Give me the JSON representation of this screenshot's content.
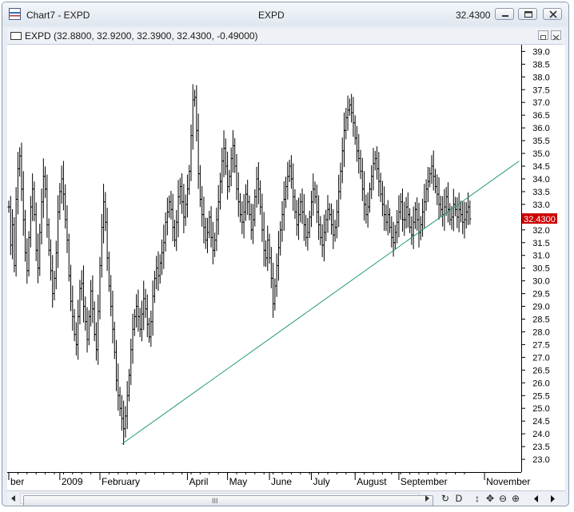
{
  "window": {
    "title": "Chart7 - EXPD",
    "center_title": "EXPD",
    "last_price": "32.4300"
  },
  "series_header": "EXPD (32.8800, 32.9200, 32.3900, 32.4300, -0.49000)",
  "toolbar": {
    "zoom_label": "D",
    "grip": "III"
  },
  "colors": {
    "trendline": "#1f9a63",
    "price_tag_bg": "#cc0000",
    "bars": "#000000"
  },
  "chart_data": {
    "type": "ohlc",
    "symbol": "EXPD",
    "last_price_label": "32.4300",
    "last_price": 32.43,
    "ylim": [
      22.5,
      39.2
    ],
    "y_ticks": [
      "39.0",
      "38.5",
      "38.0",
      "37.5",
      "37.0",
      "36.5",
      "36.0",
      "35.5",
      "35.0",
      "34.5",
      "34.0",
      "33.5",
      "33.0",
      "32.5",
      "32.0",
      "31.5",
      "31.0",
      "30.5",
      "30.0",
      "29.5",
      "29.0",
      "28.5",
      "28.0",
      "27.5",
      "27.0",
      "26.5",
      "26.0",
      "25.5",
      "25.0",
      "24.5",
      "24.0",
      "23.5",
      "23.0"
    ],
    "x_labels": [
      {
        "label": "ber",
        "bar": 0
      },
      {
        "label": "2009",
        "bar": 28
      },
      {
        "label": "February",
        "bar": 50
      },
      {
        "label": "April",
        "bar": 98
      },
      {
        "label": "May",
        "bar": 120
      },
      {
        "label": "June",
        "bar": 143
      },
      {
        "label": "July",
        "bar": 166
      },
      {
        "label": "August",
        "bar": 190
      },
      {
        "label": "September",
        "bar": 214
      },
      {
        "label": "November",
        "bar": 261
      }
    ],
    "closes": [
      32.9,
      31.4,
      32.2,
      30.6,
      33.2,
      34.4,
      34.9,
      33.6,
      32.4,
      31.1,
      30.4,
      31.7,
      32.9,
      33.6,
      32.6,
      31.2,
      30.5,
      31.9,
      33.1,
      34.1,
      33.6,
      32.2,
      31.2,
      30.4,
      29.5,
      30.1,
      31.1,
      32.7,
      33.5,
      34.0,
      33.4,
      32.4,
      31.6,
      30.2,
      29.2,
      28.6,
      27.9,
      27.5,
      28.6,
      29.7,
      29.9,
      29.0,
      28.4,
      27.7,
      28.6,
      29.6,
      28.9,
      27.9,
      27.3,
      28.8,
      30.6,
      32.1,
      33.1,
      32.3,
      30.9,
      29.8,
      29.0,
      28.1,
      27.2,
      26.1,
      25.5,
      25.0,
      24.6,
      24.2,
      24.7,
      25.5,
      26.3,
      27.3,
      28.1,
      28.6,
      29.0,
      28.6,
      28.1,
      28.7,
      29.3,
      28.9,
      28.3,
      27.8,
      28.4,
      29.4,
      30.1,
      30.5,
      30.2,
      30.7,
      31.1,
      31.5,
      32.3,
      32.7,
      33.1,
      32.8,
      32.1,
      31.6,
      32.3,
      33.3,
      33.7,
      33.1,
      32.5,
      33.0,
      33.6,
      34.3,
      35.7,
      37.1,
      37.2,
      35.9,
      34.2,
      33.2,
      32.6,
      32.1,
      31.6,
      31.9,
      32.5,
      31.7,
      31.2,
      31.6,
      32.4,
      33.1,
      33.9,
      34.7,
      35.2,
      34.5,
      33.7,
      34.1,
      34.8,
      35.3,
      34.5,
      33.6,
      33.1,
      32.6,
      32.3,
      32.7,
      33.4,
      33.1,
      32.6,
      32.0,
      32.4,
      33.3,
      34.0,
      33.6,
      32.9,
      32.0,
      31.2,
      30.9,
      31.6,
      30.9,
      30.1,
      29.1,
      29.8,
      30.6,
      31.3,
      32.0,
      32.6,
      33.2,
      33.7,
      34.1,
      34.5,
      34.0,
      33.3,
      32.7,
      32.2,
      32.6,
      33.1,
      32.7,
      32.2,
      31.7,
      31.9,
      32.5,
      33.1,
      33.6,
      33.3,
      32.7,
      32.2,
      31.7,
      31.4,
      31.9,
      32.4,
      32.8,
      32.6,
      32.2,
      31.8,
      32.1,
      32.7,
      33.5,
      34.3,
      35.1,
      35.9,
      36.4,
      36.7,
      36.9,
      36.6,
      36.2,
      35.6,
      35.1,
      34.8,
      34.3,
      33.6,
      33.0,
      32.6,
      32.9,
      33.6,
      34.1,
      34.6,
      34.8,
      34.4,
      33.9,
      33.4,
      33.0,
      32.6,
      32.3,
      32.6,
      32.1,
      31.7,
      31.5,
      31.9,
      32.3,
      32.7,
      33.1,
      32.4,
      32.4,
      32.9,
      32.6,
      32.1,
      31.8,
      32.3,
      32.8,
      32.4,
      31.9,
      32.2,
      32.7,
      33.1,
      33.6,
      33.9,
      34.2,
      34.5,
      34.1,
      33.7,
      33.4,
      33.0,
      32.8,
      32.6,
      32.9,
      33.3,
      32.8,
      32.4,
      32.5,
      33.0,
      32.8,
      32.5,
      32.8,
      32.6,
      32.3,
      32.4,
      32.7,
      32.9,
      32.43
    ],
    "trendline": {
      "start": {
        "bar": 62,
        "price": 23.6
      },
      "end": {
        "bar": 280,
        "price": 34.7
      }
    },
    "grid": false,
    "axis_side": "right"
  }
}
